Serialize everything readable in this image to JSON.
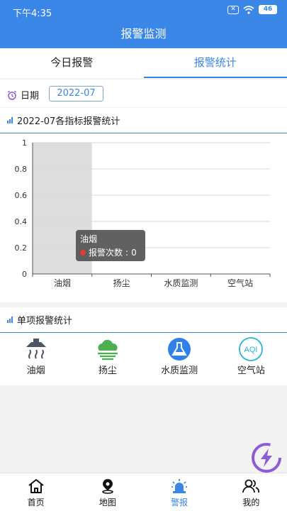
{
  "status": {
    "time": "下午4:35",
    "battery": "46"
  },
  "header": {
    "title": "报警监测"
  },
  "tabs": [
    {
      "label": "今日报警"
    },
    {
      "label": "报警统计"
    }
  ],
  "date_filter": {
    "label": "日期",
    "value": "2022-07"
  },
  "chart_section": {
    "title": "2022-07各指标报警统计"
  },
  "tooltip": {
    "title": "油烟",
    "series": "报警次数",
    "value": "0"
  },
  "chart_data": {
    "type": "bar",
    "title": "2022-07各指标报警统计",
    "categories": [
      "油烟",
      "扬尘",
      "水质监测",
      "空气站"
    ],
    "series": [
      {
        "name": "报警次数",
        "values": [
          0,
          0,
          0,
          0
        ]
      }
    ],
    "ylim": [
      0,
      1
    ],
    "yticks": [
      "0",
      "0.2",
      "0.4",
      "0.6",
      "0.8",
      "1"
    ],
    "grid": true,
    "highlighted_category": "油烟"
  },
  "single_section": {
    "title": "单项报警统计"
  },
  "single_items": [
    {
      "label": "油烟",
      "icon": "range-hood-icon"
    },
    {
      "label": "扬尘",
      "icon": "dust-cloud-icon"
    },
    {
      "label": "水质监测",
      "icon": "flask-icon"
    },
    {
      "label": "空气站",
      "icon": "aqi-icon"
    }
  ],
  "bottom_nav": [
    {
      "label": "首页",
      "icon": "home-icon"
    },
    {
      "label": "地图",
      "icon": "map-pin-icon"
    },
    {
      "label": "警报",
      "icon": "alarm-light-icon",
      "active": true
    },
    {
      "label": "我的",
      "icon": "users-icon"
    }
  ],
  "colors": {
    "primary": "#3b87e8",
    "tooltip_dot": "#e53935",
    "highlight_band": "#dddddd"
  }
}
